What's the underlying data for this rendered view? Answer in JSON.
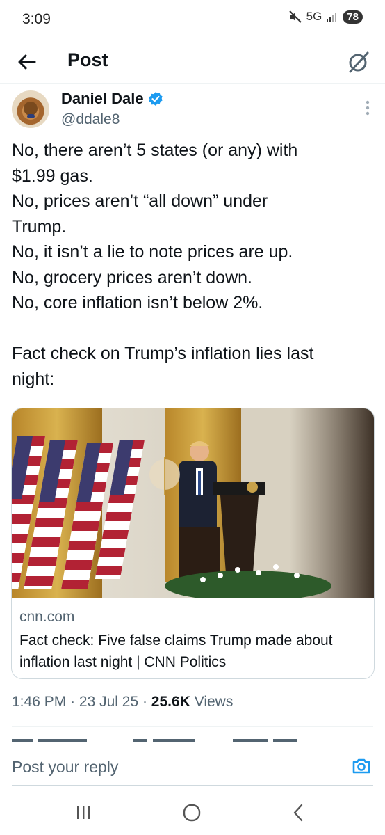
{
  "status_bar": {
    "time": "3:09",
    "network": "5G",
    "battery": "78"
  },
  "header": {
    "title": "Post"
  },
  "author": {
    "name": "Daniel Dale",
    "handle": "@ddale8"
  },
  "post": {
    "lines": [
      "No, there aren’t 5 states (or any) with\n$1.99 gas.",
      "No, prices aren’t “all down” under\nTrump.",
      "No, it isn’t a lie to note prices are up.",
      "No, grocery prices aren’t down.",
      "No, core inflation isn’t below 2%.",
      "",
      "Fact check on Trump’s inflation lies last\nnight:"
    ]
  },
  "link_card": {
    "domain": "cnn.com",
    "title": "Fact check: Five false claims Trump made about inflation last night | CNN Politics"
  },
  "meta": {
    "time": "1:46 PM",
    "date": "23 Jul 25",
    "views_count": "25.6K",
    "views_label": "Views"
  },
  "reply": {
    "placeholder": "Post your reply"
  },
  "colors": {
    "accent": "#1d9bf0",
    "text": "#0f1419",
    "secondary": "#536471"
  }
}
